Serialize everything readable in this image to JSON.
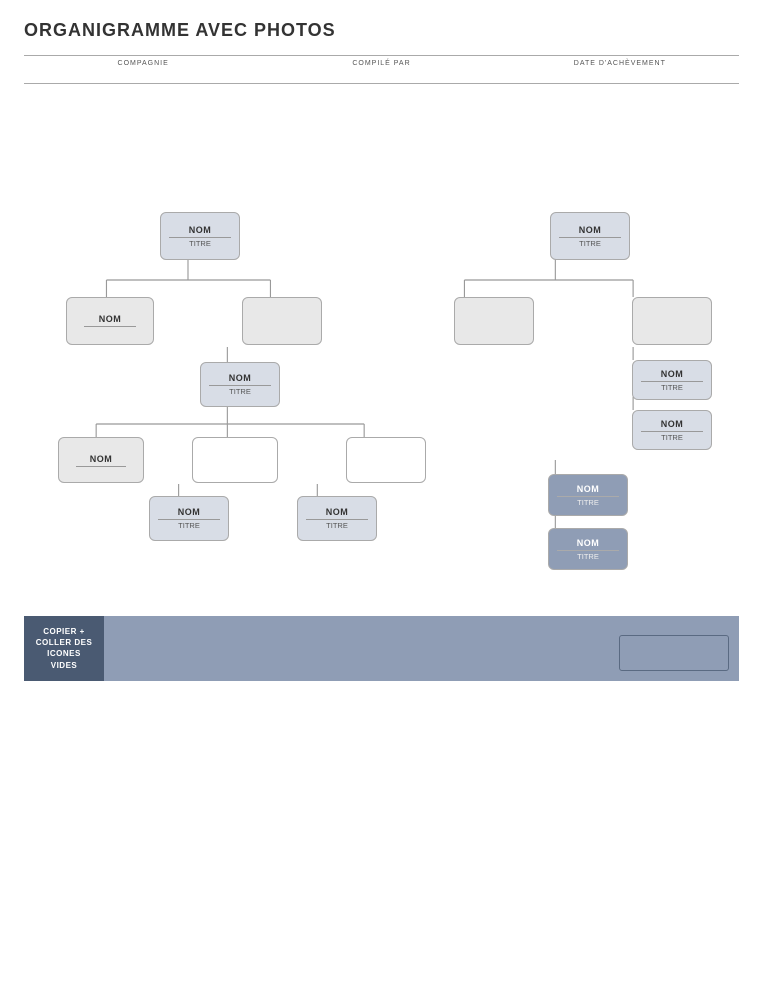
{
  "page": {
    "title": "ORGANIGRAMME AVEC PHOTOS",
    "header": {
      "company_label": "COMPAGNIE",
      "compiled_label": "COMPILÉ PAR",
      "date_label": "DATE D'ACHÈVEMENT"
    },
    "bottom_bar": {
      "label": "COPIER +\nCOLLER DES\nICONES VIDES"
    },
    "nodes": {
      "nom": "NOM",
      "titre": "TITRE"
    }
  }
}
